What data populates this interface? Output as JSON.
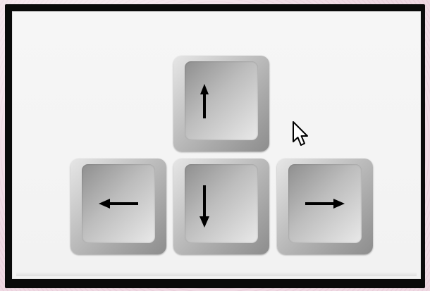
{
  "keys": [
    {
      "name": "up",
      "icon": "arrow-up-icon"
    },
    {
      "name": "left",
      "icon": "arrow-left-icon"
    },
    {
      "name": "down",
      "icon": "arrow-down-icon"
    },
    {
      "name": "right",
      "icon": "arrow-right-icon"
    }
  ],
  "cursor": {
    "icon": "mouse-pointer-icon"
  },
  "colors": {
    "frame": "#0a0a0a",
    "panel": "#f4f4f4",
    "key_light": "#e6e6e6",
    "key_dark": "#8d8d8d",
    "arrow": "#000000",
    "background": "#f1dde6"
  }
}
